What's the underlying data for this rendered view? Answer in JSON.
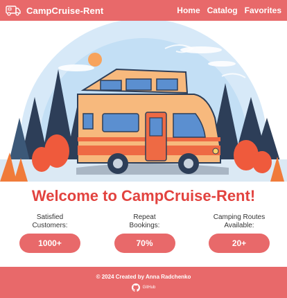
{
  "header": {
    "brand": "CampCruise-Rent",
    "brand_icon": "camper-van-icon",
    "nav": [
      "Home",
      "Catalog",
      "Favorites"
    ]
  },
  "hero": {
    "image": "camper-van-illustration"
  },
  "welcome": "Welcome to CampCruise-Rent!",
  "stats": [
    {
      "label": "Satisfied\nCustomers:",
      "value": "1000+"
    },
    {
      "label": "Repeat\nBookings:",
      "value": "70%"
    },
    {
      "label": "Camping Routes\nAvailable:",
      "value": "20+"
    }
  ],
  "footer": {
    "copyright": "© 2024 Created by Anna Radchenko",
    "github_label": "GitHub",
    "github_icon": "github-icon"
  },
  "colors": {
    "accent": "#e8696a",
    "title": "#e2433f"
  }
}
